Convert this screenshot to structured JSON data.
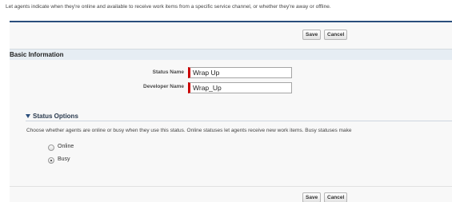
{
  "intro_text": "Let agents indicate when they're online and available to receive work items from a specific service channel, or whether they're away or offline.",
  "buttons": {
    "save_label": "Save",
    "cancel_label": "Cancel"
  },
  "basic_info": {
    "title": "Basic Information",
    "status_name": {
      "label": "Status Name",
      "value": "Wrap Up"
    },
    "developer_name": {
      "label": "Developer Name",
      "value": "Wrap_Up"
    }
  },
  "status_options": {
    "title": "Status Options",
    "description": "Choose whether agents are online or busy when they use this status. Online statuses let agents receive new work items. Busy statuses make",
    "options": [
      {
        "label": "Online",
        "selected": false
      },
      {
        "label": "Busy",
        "selected": true
      }
    ]
  },
  "colors": {
    "header_border": "#2a4e7c",
    "section_bg": "#e6edf3",
    "required_marker": "#cc0000"
  }
}
